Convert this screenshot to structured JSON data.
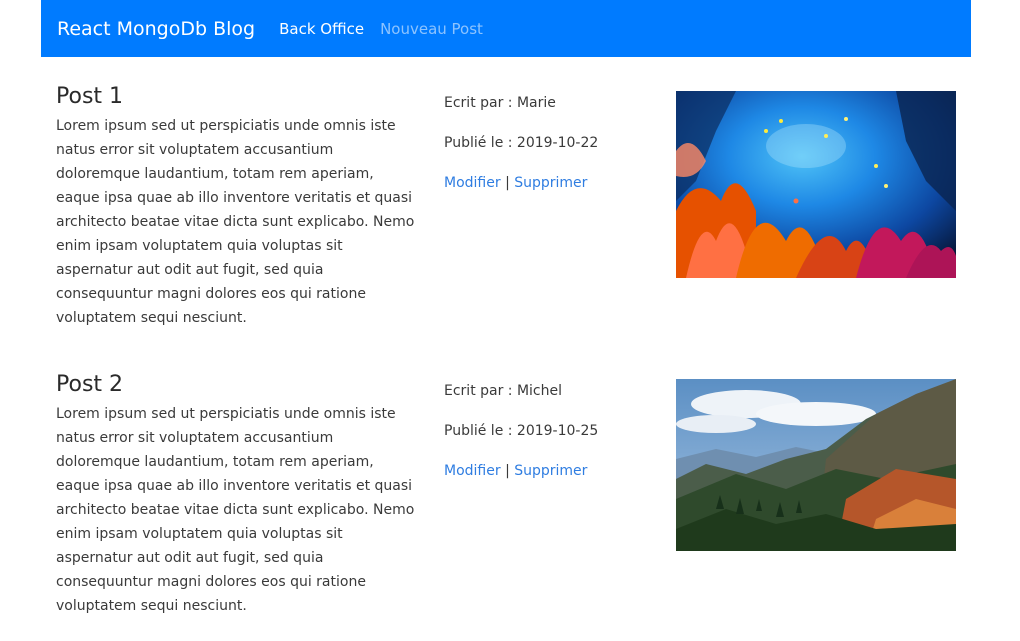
{
  "navbar": {
    "brand": "React MongoDb Blog",
    "links": [
      {
        "label": "Back Office"
      },
      {
        "label": "Nouveau Post"
      }
    ],
    "bg_color": "#007bff"
  },
  "posts": [
    {
      "title": "Post 1",
      "body": "Lorem ipsum sed ut perspiciatis unde omnis iste natus error sit voluptatem accusantium doloremque laudantium, totam rem aperiam, eaque ipsa quae ab illo inventore veritatis et quasi architecto beatae vitae dicta sunt explicabo. Nemo enim ipsam voluptatem quia voluptas sit aspernatur aut odit aut fugit, sed quia consequuntur magni dolores eos qui ratione voluptatem sequi nesciunt.",
      "author": "Ecrit par : Marie",
      "date": "Publié le : 2019-10-22",
      "edit_label": "Modifier",
      "separator": "|",
      "delete_label": "Supprimer",
      "image": "coral-reef-photo"
    },
    {
      "title": "Post 2",
      "body": "Lorem ipsum sed ut perspiciatis unde omnis iste natus error sit voluptatem accusantium doloremque laudantium, totam rem aperiam, eaque ipsa quae ab illo inventore veritatis et quasi architecto beatae vitae dicta sunt explicabo. Nemo enim ipsam voluptatem quia voluptas sit aspernatur aut odit aut fugit, sed quia consequuntur magni dolores eos qui ratione voluptatem sequi nesciunt.",
      "author": "Ecrit par : Michel",
      "date": "Publié le : 2019-10-25",
      "edit_label": "Modifier",
      "separator": "|",
      "delete_label": "Supprimer",
      "image": "mountain-landscape-photo"
    }
  ],
  "link_color": "#2f7de1"
}
